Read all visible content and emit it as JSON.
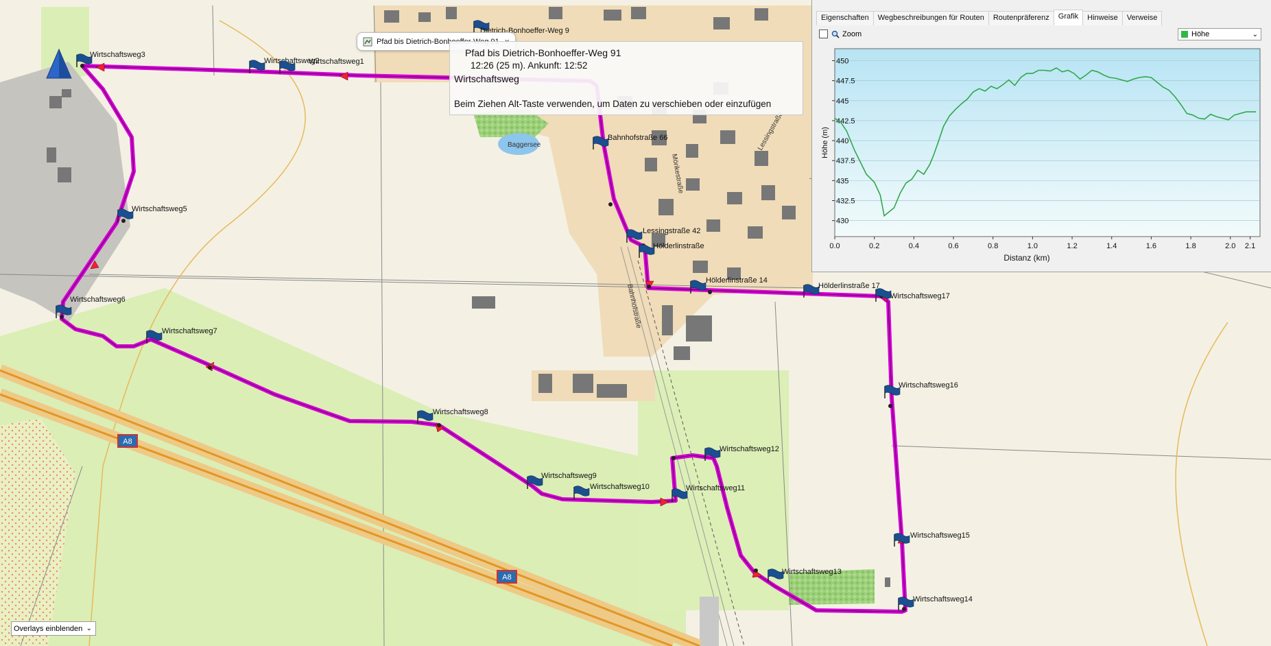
{
  "map": {
    "flags": [
      {
        "name": "Wirtschaftsweg3"
      },
      {
        "name": "Wirtschaftsweg2"
      },
      {
        "name": "Wirtschaftsweg1"
      },
      {
        "name": "Wirtschaftsweg5"
      },
      {
        "name": "Wirtschaftsweg6"
      },
      {
        "name": "Wirtschaftsweg7"
      },
      {
        "name": "Wirtschaftsweg8"
      },
      {
        "name": "Wirtschaftsweg9"
      },
      {
        "name": "Wirtschaftsweg10"
      },
      {
        "name": "Wirtschaftsweg11"
      },
      {
        "name": "Wirtschaftsweg12"
      },
      {
        "name": "Wirtschaftsweg13"
      },
      {
        "name": "Wirtschaftsweg14"
      },
      {
        "name": "Wirtschaftsweg15"
      },
      {
        "name": "Wirtschaftsweg16"
      },
      {
        "name": "Wirtschaftsweg17"
      },
      {
        "name": "Bahnhofstraße 66"
      },
      {
        "name": "Lessingstraße 42"
      },
      {
        "name": "Hölderlinstraße"
      },
      {
        "name": "Hölderlinstraße 14"
      },
      {
        "name": "Hölderlinstraße 17"
      },
      {
        "name": "Dietrich-Bonhoeffer-Weg 9"
      }
    ],
    "labels": {
      "bahnhofstrasse": "Bahnhofstraße",
      "lessingstrasse": "Lessingstraße",
      "moerikestrasse": "Mörikestraße",
      "pond": "Baggersee",
      "autobahn": "A8"
    }
  },
  "tooltip": {
    "text": "Pfad bis Dietrich-Bonhoeffer-Weg 91",
    "close": "×"
  },
  "drag_info": {
    "line1": "Pfad bis Dietrich-Bonhoeffer-Weg 91",
    "line2": "12:26 (25 m). Ankunft: 12:52",
    "line3": "Wirtschaftsweg",
    "line4": "Beim Ziehen Alt-Taste verwenden, um Daten zu verschieben oder einzufügen"
  },
  "panel": {
    "tabs": [
      "Eigenschaften",
      "Wegbeschreibungen für Routen",
      "Routenpräferenz",
      "Grafik",
      "Hinweise",
      "Verweise"
    ],
    "active_tab": "Grafik",
    "zoom_label": "Zoom",
    "dropdown_value": "Höhe",
    "dropdown_color": "#2fb84a"
  },
  "overlays_button": "Overlays einblenden",
  "chart_data": {
    "type": "line",
    "xlabel": "Distanz  (km)",
    "ylabel": "Höhe (m)",
    "xlim": [
      0,
      2.15
    ],
    "ylim": [
      428,
      451.5
    ],
    "x_ticks": [
      0.0,
      0.2,
      0.4,
      0.6,
      0.8,
      1.0,
      1.2,
      1.4,
      1.6,
      1.8,
      2.0,
      2.1
    ],
    "x_tick_labels": [
      "0.0",
      "0.2",
      "0.4",
      "0.6",
      "0.8",
      "1.0",
      "1.2",
      "1.4",
      "1.6",
      "1.8",
      "2.0",
      "2.1"
    ],
    "y_ticks": [
      430,
      432.5,
      435,
      437.5,
      440,
      442.5,
      445,
      447.5,
      450
    ],
    "y_tick_labels": [
      "430",
      "432.5",
      "435",
      "437.5",
      "440",
      "442.5",
      "445",
      "447.5",
      "450"
    ],
    "grid": true,
    "color": "#2fa84a",
    "series": [
      {
        "x": [
          0.0,
          0.03,
          0.06,
          0.1,
          0.13,
          0.16,
          0.2,
          0.23,
          0.25,
          0.27,
          0.3,
          0.33,
          0.36,
          0.39,
          0.42,
          0.45,
          0.48,
          0.5,
          0.52,
          0.55,
          0.58,
          0.61,
          0.64,
          0.67,
          0.7,
          0.73,
          0.76,
          0.79,
          0.82,
          0.85,
          0.88,
          0.91,
          0.94,
          0.97,
          1.0,
          1.03,
          1.06,
          1.09,
          1.12,
          1.15,
          1.18,
          1.21,
          1.24,
          1.27,
          1.3,
          1.33,
          1.36,
          1.39,
          1.42,
          1.45,
          1.48,
          1.51,
          1.54,
          1.57,
          1.6,
          1.63,
          1.66,
          1.69,
          1.72,
          1.75,
          1.78,
          1.81,
          1.84,
          1.87,
          1.9,
          1.93,
          1.96,
          1.99,
          2.02,
          2.05,
          2.08,
          2.11,
          2.13
        ],
        "y": [
          442.8,
          442.3,
          441.2,
          438.8,
          437.3,
          435.8,
          434.8,
          433.2,
          430.6,
          431.0,
          431.6,
          433.4,
          434.7,
          435.2,
          436.3,
          435.8,
          437.0,
          438.2,
          439.6,
          441.8,
          443.1,
          443.9,
          444.6,
          445.2,
          446.1,
          446.5,
          446.2,
          446.8,
          446.5,
          447.0,
          447.6,
          446.9,
          447.9,
          448.4,
          448.4,
          448.8,
          448.8,
          448.7,
          449.1,
          448.6,
          448.8,
          448.4,
          447.7,
          448.2,
          448.8,
          448.6,
          448.2,
          447.9,
          447.8,
          447.6,
          447.4,
          447.7,
          447.9,
          448.0,
          447.9,
          447.3,
          446.7,
          446.3,
          445.5,
          444.5,
          443.4,
          443.2,
          442.8,
          442.7,
          443.3,
          443.0,
          442.8,
          442.6,
          443.2,
          443.4,
          443.6,
          443.6,
          443.6
        ]
      }
    ]
  }
}
